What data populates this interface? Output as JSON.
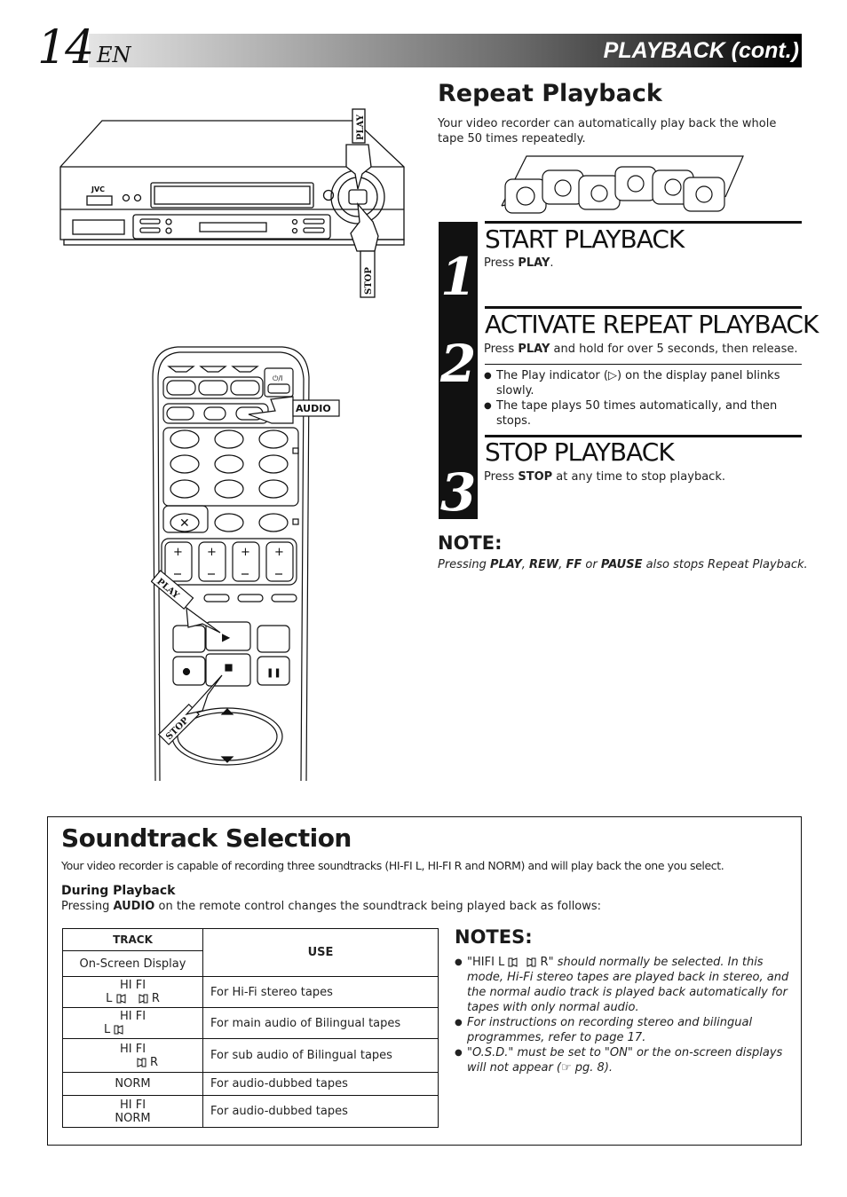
{
  "header": {
    "page_number": "14",
    "language": "EN",
    "section": "PLAYBACK (cont.)"
  },
  "illustrations": {
    "vcr": {
      "brand": "JVC",
      "labels": {
        "play": "PLAY",
        "stop": "STOP"
      }
    },
    "remote": {
      "labels": {
        "audio": "AUDIO",
        "play": "PLAY",
        "stop": "STOP"
      }
    }
  },
  "repeat_playback": {
    "title": "Repeat Playback",
    "intro": "Your video recorder can automatically play back the whole tape 50 times repeatedly.",
    "steps": [
      {
        "number": "1",
        "heading": "START PLAYBACK",
        "text_pre": "Press ",
        "text_bold": "PLAY",
        "text_post": "."
      },
      {
        "number": "2",
        "heading": "ACTIVATE REPEAT PLAYBACK",
        "text_pre": "Press ",
        "text_bold": "PLAY",
        "text_post": " and hold for over 5 seconds, then release.",
        "bullets": [
          "The Play indicator (▷) on the display panel blinks slowly.",
          "The tape plays 50 times automatically, and then stops."
        ]
      },
      {
        "number": "3",
        "heading": "STOP PLAYBACK",
        "text_pre": "Press ",
        "text_bold": "STOP",
        "text_post": " at any time to stop playback."
      }
    ],
    "note": {
      "title": "NOTE:",
      "parts": [
        "Pressing ",
        "PLAY",
        ", ",
        "REW",
        ", ",
        "FF",
        " or ",
        "PAUSE",
        " also stops Repeat Playback."
      ]
    }
  },
  "soundtrack": {
    "title": "Soundtrack Selection",
    "intro": "Your video recorder is capable of recording three soundtracks (HI-FI L, HI-FI R and NORM) and will play back the one you select.",
    "subheading": "During Playback",
    "desc_pre": "Pressing ",
    "desc_bold": "AUDIO",
    "desc_post": " on the remote control changes the soundtrack being played back as follows:",
    "table": {
      "header_track": "TRACK",
      "header_display": "On-Screen Display",
      "header_use": "USE",
      "rows": [
        {
          "line1": "HI FI",
          "left": "L",
          "right": "R",
          "speakers": "both",
          "use": "For Hi-Fi stereo tapes"
        },
        {
          "line1": "HI FI",
          "left": "L",
          "right": "",
          "speakers": "left",
          "use": "For main audio of Bilingual tapes"
        },
        {
          "line1": "HI FI",
          "left": "",
          "right": "R",
          "speakers": "right",
          "use": "For sub audio of Bilingual tapes"
        },
        {
          "line1": "NORM",
          "left": "",
          "right": "",
          "speakers": "none",
          "use": "For audio-dubbed tapes"
        },
        {
          "line1": "HI FI",
          "line2": "NORM",
          "speakers": "none",
          "use": "For audio-dubbed tapes"
        }
      ]
    },
    "notes": {
      "title": "NOTES:",
      "item1_quote_pre": "\"HIFI L ",
      "item1_quote_post": " R\"",
      "item1_rest": " should normally be selected. In this mode, Hi-Fi stereo tapes are played back in stereo, and the normal audio track is played back automatically for tapes with only normal audio.",
      "item2": "For instructions on recording stereo and bilingual programmes, refer to page 17.",
      "item3": "\"O.S.D.\" must be set to \"ON\" or the on-screen displays will not appear (☞ pg. 8)."
    }
  }
}
